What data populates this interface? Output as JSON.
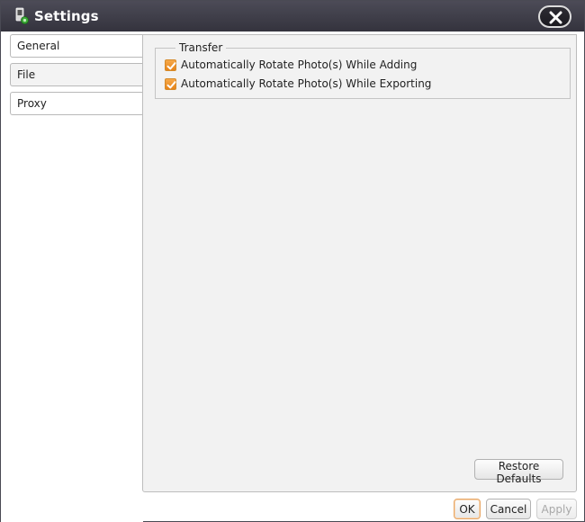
{
  "window": {
    "title": "Settings"
  },
  "icons": {
    "app": "camera-phone-icon",
    "close": "close-icon",
    "check": "checkmark-icon"
  },
  "colors": {
    "titlebar": "#3f3e49",
    "checkbox_accent": "#f29b35",
    "ok_border": "#e8a766"
  },
  "sidebar": {
    "tabs": [
      {
        "label": "General"
      },
      {
        "label": "File"
      },
      {
        "label": "Proxy"
      }
    ],
    "selected": "File"
  },
  "transfer": {
    "legend": "Transfer",
    "options": [
      {
        "label": "Automatically Rotate Photo(s) While Adding",
        "checked": true
      },
      {
        "label": "Automatically Rotate Photo(s) While Exporting",
        "checked": true
      }
    ]
  },
  "buttons": {
    "restore_defaults": "Restore Defaults",
    "ok": "OK",
    "cancel": "Cancel",
    "apply": "Apply",
    "apply_enabled": false
  }
}
